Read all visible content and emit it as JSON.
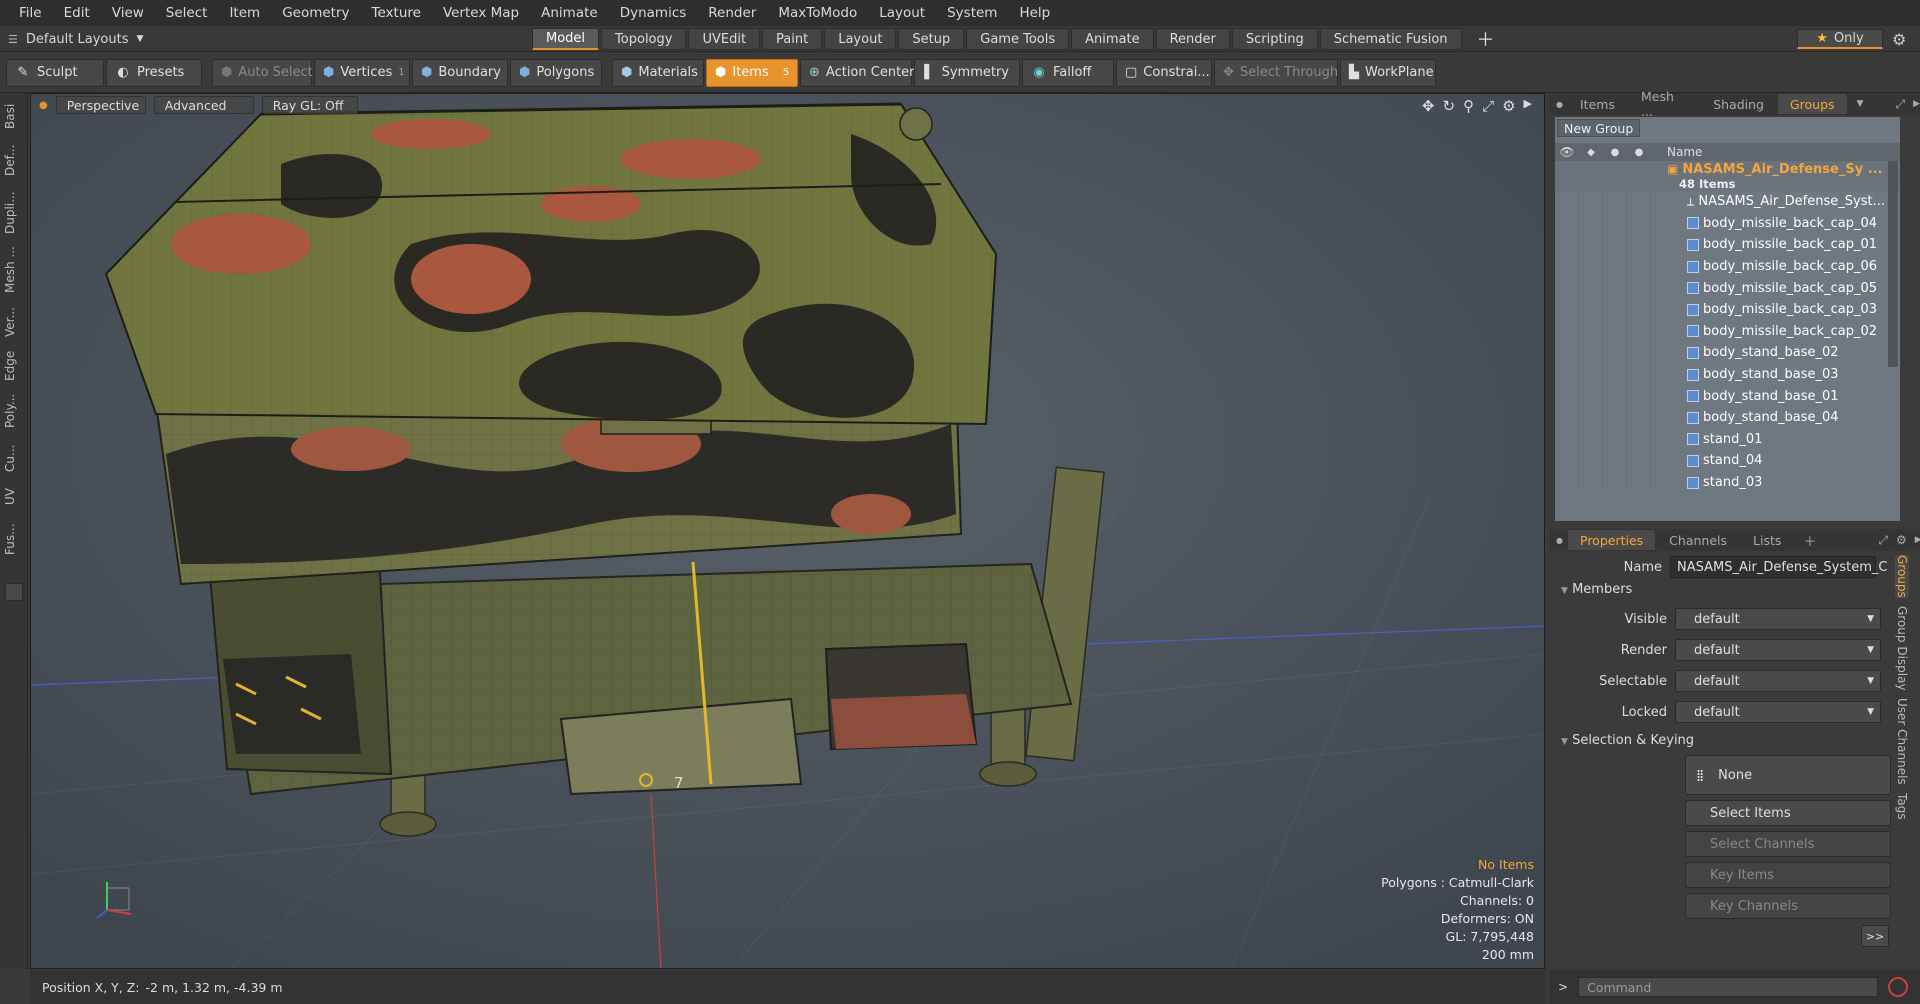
{
  "menu": [
    "File",
    "Edit",
    "View",
    "Select",
    "Item",
    "Geometry",
    "Texture",
    "Vertex Map",
    "Animate",
    "Dynamics",
    "Render",
    "MaxToModo",
    "Layout",
    "System",
    "Help"
  ],
  "layout": {
    "selector": "Default Layouts",
    "tabs": [
      "Model",
      "Topology",
      "UVEdit",
      "Paint",
      "Layout",
      "Setup",
      "Game Tools",
      "Animate",
      "Render",
      "Scripting",
      "Schematic Fusion"
    ],
    "active_tab": "Model",
    "only_label": "Only"
  },
  "toolbar": {
    "sculpt": "Sculpt",
    "presets": "Presets",
    "auto_select": "Auto Select",
    "vertices": "Vertices",
    "vertices_count": "1",
    "boundary": "Boundary",
    "polygons": "Polygons",
    "materials": "Materials",
    "items": "Items",
    "items_count": "5",
    "action_center": "Action Center",
    "symmetry": "Symmetry",
    "falloff": "Falloff",
    "constraints": "Constrai...",
    "select_through": "Select Through",
    "workplane": "WorkPlane"
  },
  "left_tabs": [
    "Basi",
    "Def...",
    "Dupli...",
    "Mesh ...",
    "Ver...",
    "Edge",
    "Poly...",
    "Cu...",
    "UV",
    "Fus..."
  ],
  "viewport": {
    "view_mode": "Perspective",
    "shading": "Advanced",
    "raygl": "Ray GL: Off",
    "info": {
      "items": "No Items",
      "polygons": "Polygons : Catmull-Clark",
      "channels": "Channels: 0",
      "deformers": "Deformers: ON",
      "gl": "GL: 7,795,448",
      "scale": "200 mm"
    },
    "plate_number": "7"
  },
  "status": {
    "position_label": "Position X, Y, Z:",
    "position_value": "-2 m, 1.32 m, -4.39 m"
  },
  "top_panel": {
    "tabs": [
      "Items",
      "Mesh ...",
      "Shading",
      "Groups"
    ],
    "active_tab": "Groups",
    "new_group": "New Group",
    "name_header": "Name",
    "group_name": "NASAMS_Air_Defense_Sy ...",
    "group_count": "48 Items",
    "items": [
      "NASAMS_Air_Defense_Syst...",
      "body_missile_back_cap_04",
      "body_missile_back_cap_01",
      "body_missile_back_cap_06",
      "body_missile_back_cap_05",
      "body_missile_back_cap_03",
      "body_missile_back_cap_02",
      "body_stand_base_02",
      "body_stand_base_03",
      "body_stand_base_01",
      "body_stand_base_04",
      "stand_01",
      "stand_04",
      "stand_03"
    ]
  },
  "props_panel": {
    "tabs": [
      "Properties",
      "Channels",
      "Lists"
    ],
    "active_tab": "Properties",
    "name_label": "Name",
    "name_value": "NASAMS_Air_Defense_System_C",
    "members_section": "Members",
    "visible_label": "Visible",
    "visible_value": "default",
    "render_label": "Render",
    "render_value": "default",
    "selectable_label": "Selectable",
    "selectable_value": "default",
    "locked_label": "Locked",
    "locked_value": "default",
    "keying_section": "Selection & Keying",
    "none_btn": "None",
    "select_items": "Select Items",
    "select_channels": "Select Channels",
    "key_items": "Key Items",
    "key_channels": "Key Channels",
    "more": ">>",
    "side_tabs": [
      "Groups",
      "Group Display",
      "User Channels",
      "Tags"
    ]
  },
  "command": {
    "placeholder": "Command"
  },
  "colors": {
    "accent": "#e8932b",
    "camo_green": "#6b6e3e",
    "camo_dark": "#2b2a27",
    "camo_red": "#a65a44"
  }
}
